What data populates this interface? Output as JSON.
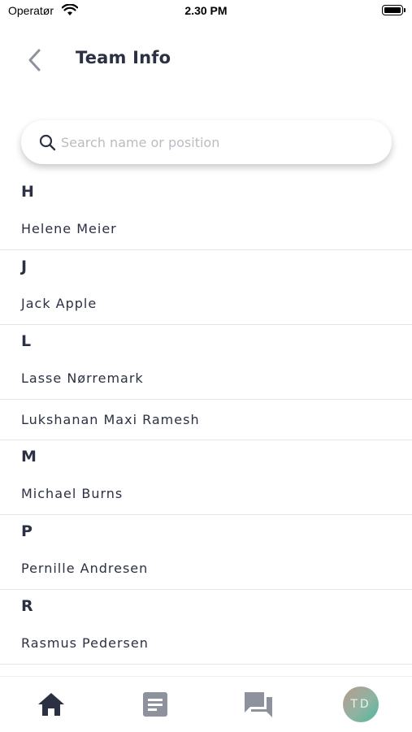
{
  "status_bar": {
    "carrier": "Operatør",
    "time": "2.30 PM"
  },
  "header": {
    "title": "Team Info"
  },
  "search": {
    "placeholder": "Search name or position",
    "value": ""
  },
  "sections": [
    {
      "letter": "H",
      "members": [
        "Helene Meier"
      ]
    },
    {
      "letter": "J",
      "members": [
        "Jack Apple"
      ]
    },
    {
      "letter": "L",
      "members": [
        "Lasse Nørremark",
        "Lukshanan Maxi Ramesh"
      ]
    },
    {
      "letter": "M",
      "members": [
        "Michael Burns"
      ]
    },
    {
      "letter": "P",
      "members": [
        "Pernille Andresen"
      ]
    },
    {
      "letter": "R",
      "members": [
        "Rasmus Pedersen"
      ]
    }
  ],
  "tab_bar": {
    "tabs": [
      {
        "icon": "home-icon",
        "active": true
      },
      {
        "icon": "document-icon",
        "active": false
      },
      {
        "icon": "chat-icon",
        "active": false
      },
      {
        "icon": "avatar",
        "initials": "TD",
        "active": false
      }
    ]
  },
  "colors": {
    "active_tab": "#2b3142",
    "inactive_tab": "#8e929c",
    "text": "#2b3142",
    "divider": "#e3e4e8"
  }
}
